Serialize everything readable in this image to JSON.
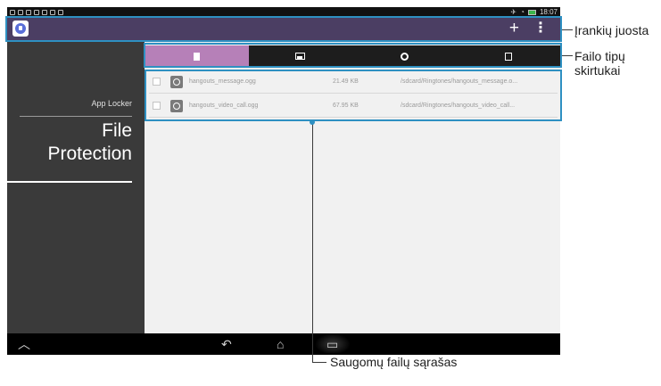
{
  "status_bar": {
    "time": "18:07"
  },
  "action_bar": {
    "add_label": "+",
    "overflow_label": "⋮"
  },
  "sidebar": {
    "subtitle": "App Locker",
    "title": "File Protection"
  },
  "tabs": [
    {
      "icon": "document-icon",
      "active": true
    },
    {
      "icon": "image-icon",
      "active": false
    },
    {
      "icon": "music-icon",
      "active": false
    },
    {
      "icon": "list-icon",
      "active": false
    }
  ],
  "files": [
    {
      "name": "hangouts_message.ogg",
      "size": "21.49 KB",
      "path": "/sdcard/Ringtones/hangouts_message.o..."
    },
    {
      "name": "hangouts_video_call.ogg",
      "size": "67.95 KB",
      "path": "/sdcard/Ringtones/hangouts_video_call..."
    }
  ],
  "nav": {
    "home_up": "︿",
    "back": "↶",
    "home": "⌂",
    "recent": "▭"
  },
  "callouts": {
    "toolbar": "Įrankių juosta",
    "file_tabs_line1": "Failo tipų",
    "file_tabs_line2": "skirtukai",
    "file_list": "Saugomų failų sąrašas"
  },
  "colors": {
    "action_bar": "#4b3e63",
    "tab_active": "#b680b8",
    "callout_frame": "#2e90c2",
    "sidebar": "#3a3a3a"
  }
}
